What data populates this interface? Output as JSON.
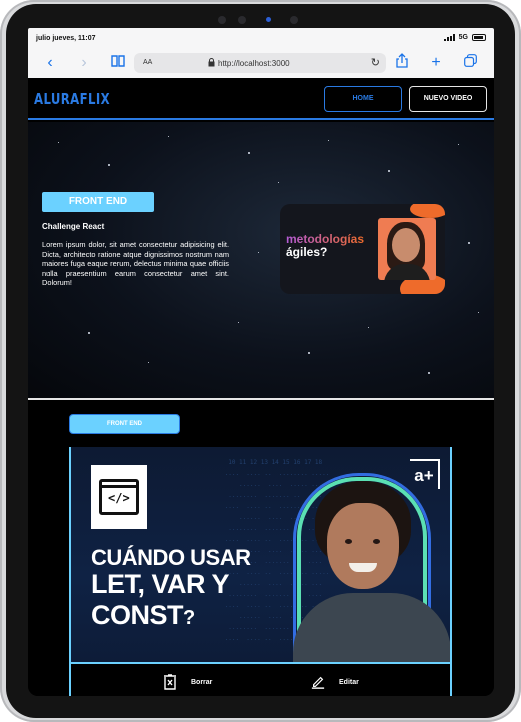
{
  "status_bar": {
    "time": "julio jueves, 11:07",
    "network": "5G"
  },
  "browser": {
    "reader_label": "AA",
    "url": "http://localhost:3000",
    "icons": [
      "back-icon",
      "forward-icon",
      "bookmarks-icon",
      "lock-icon",
      "reload-icon",
      "share-icon",
      "new-tab-icon",
      "tabs-icon"
    ]
  },
  "navbar": {
    "logo": "ALURAFLIX",
    "home_label": "HOME",
    "new_video_label": "NUEVO VIDEO"
  },
  "hero": {
    "category": "FRONT END",
    "title": "Challenge React",
    "description": "Lorem ipsum dolor, sit amet consectetur adipisicing elit. Dicta, architecto ratione atque dignissimos nostrum nam maiores fuga eaque rerum, delectus minima quae officiis nulla praesentium earum consectetur amet sint. Dolorum!",
    "card_line1": "metodologías",
    "card_line2": "ágiles?"
  },
  "section": {
    "category": "FRONT END"
  },
  "video": {
    "code_glyph": "</>",
    "brand_mark": "a+",
    "line1": "CUÁNDO USAR",
    "line2": "LET, VAR Y",
    "line3": "CONST",
    "line3_mark": "?",
    "delete_label": "Borrar",
    "edit_label": "Editar"
  },
  "colors": {
    "accent": "#2A7AE2",
    "tag": "#6BD1FF",
    "highlight": "#5BE0B3"
  }
}
